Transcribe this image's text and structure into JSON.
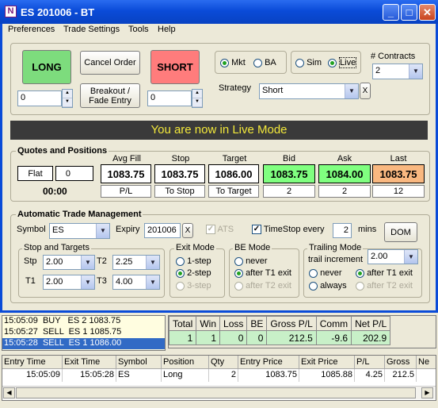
{
  "window": {
    "title": "ES 201006 - BT",
    "icon_glyph": "N"
  },
  "menu": [
    "Preferences",
    "Trade Settings",
    "Tools",
    "Help"
  ],
  "buttons": {
    "long": "LONG",
    "cancel": "Cancel Order",
    "short": "SHORT",
    "breakout": "Breakout / Fade Entry",
    "dom": "DOM",
    "x": "X"
  },
  "qty": {
    "long": "0",
    "short": "0"
  },
  "order_type": {
    "mkt": "Mkt",
    "ba": "BA",
    "selected": "Mkt"
  },
  "mode": {
    "sim": "Sim",
    "live": "Live",
    "selected": "Live"
  },
  "contracts": {
    "label": "# Contracts",
    "value": "2"
  },
  "strategy": {
    "label": "Strategy",
    "value": "Short"
  },
  "banner": "You are now in Live Mode",
  "quotes": {
    "title": "Quotes and Positions",
    "position": "Flat",
    "position_qty": "0",
    "time": "00:00",
    "headers": [
      "Avg Fill",
      "Stop",
      "Target",
      "Bid",
      "Ask",
      "Last"
    ],
    "values": [
      "1083.75",
      "1083.75",
      "1086.00",
      "1083.75",
      "1084.00",
      "1083.75"
    ],
    "subs": [
      "P/L",
      "To Stop",
      "To Target",
      "2",
      "2",
      "12"
    ],
    "colors": {
      "bid": "#80ff80",
      "ask": "#80ff80",
      "last": "#f9b880"
    }
  },
  "atm": {
    "title": "Automatic Trade Management",
    "symbol_label": "Symbol",
    "symbol": "ES",
    "expiry_label": "Expiry",
    "expiry": "201006",
    "ats": "ATS",
    "timestop": "TimeStop every",
    "timestop_value": "2",
    "mins": "mins",
    "stops_title": "Stop and Targets",
    "stp": "Stp",
    "stp_val": "2.00",
    "t1": "T1",
    "t1_val": "2.00",
    "t2": "T2",
    "t2_val": "2.25",
    "t3": "T3",
    "t3_val": "4.00",
    "exit_title": "Exit Mode",
    "exit_opts": [
      "1-step",
      "2-step",
      "3-step"
    ],
    "be_title": "BE Mode",
    "be_opts": [
      "never",
      "after T1 exit",
      "after T2 exit"
    ],
    "trail_title": "Trailing Mode",
    "trail_inc_label": "trail increment",
    "trail_inc": "2.00",
    "trail_opts": [
      "never",
      "after T1 exit",
      "always",
      "after T2 exit"
    ]
  },
  "log": [
    {
      "time": "15:05:09",
      "side": "BUY",
      "text": "ES 2 1083.75"
    },
    {
      "time": "15:05:27",
      "side": "SELL",
      "text": "ES 1 1085.75"
    },
    {
      "time": "15:05:28",
      "side": "SELL",
      "text": "ES 1 1086.00"
    }
  ],
  "stats": {
    "headers": [
      "Total",
      "Win",
      "Loss",
      "BE",
      "Gross P/L",
      "Comm",
      "Net P/L"
    ],
    "values": [
      "1",
      "1",
      "0",
      "0",
      "212.5",
      "-9.6",
      "202.9"
    ]
  },
  "trades": {
    "headers": [
      "Entry Time",
      "Exit Time",
      "Symbol",
      "Position",
      "Qty",
      "Entry Price",
      "Exit Price",
      "P/L",
      "Gross",
      "Ne"
    ],
    "rows": [
      [
        "15:05:09",
        "15:05:28",
        "ES",
        "Long",
        "2",
        "1083.75",
        "1085.88",
        "4.25",
        "212.5",
        ""
      ]
    ]
  }
}
